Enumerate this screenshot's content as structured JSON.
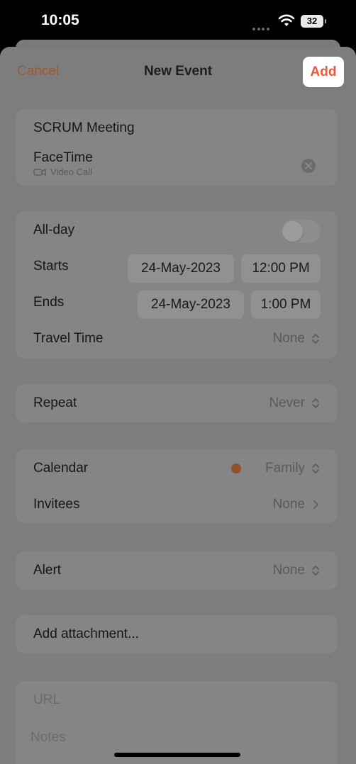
{
  "status_bar": {
    "time": "10:05",
    "battery": "32"
  },
  "nav": {
    "cancel": "Cancel",
    "title": "New Event",
    "add": "Add"
  },
  "event": {
    "title": "SCRUM Meeting",
    "location": "FaceTime",
    "location_sub": "Video Call"
  },
  "dates": {
    "allday_label": "All-day",
    "starts_label": "Starts",
    "starts_date": "24-May-2023",
    "starts_time": "12:00 PM",
    "ends_label": "Ends",
    "ends_date": "24-May-2023",
    "ends_time": "1:00 PM",
    "travel_label": "Travel Time",
    "travel_value": "None"
  },
  "repeat": {
    "label": "Repeat",
    "value": "Never"
  },
  "calendar": {
    "label": "Calendar",
    "value": "Family",
    "color": "#8f5229"
  },
  "invitees": {
    "label": "Invitees",
    "value": "None"
  },
  "alert": {
    "label": "Alert",
    "value": "None"
  },
  "attachment": {
    "label": "Add attachment..."
  },
  "url": {
    "placeholder": "URL"
  },
  "notes": {
    "placeholder": "Notes"
  },
  "colors": {
    "accent": "#ea5a3b",
    "cancel": "#9b5a33"
  }
}
